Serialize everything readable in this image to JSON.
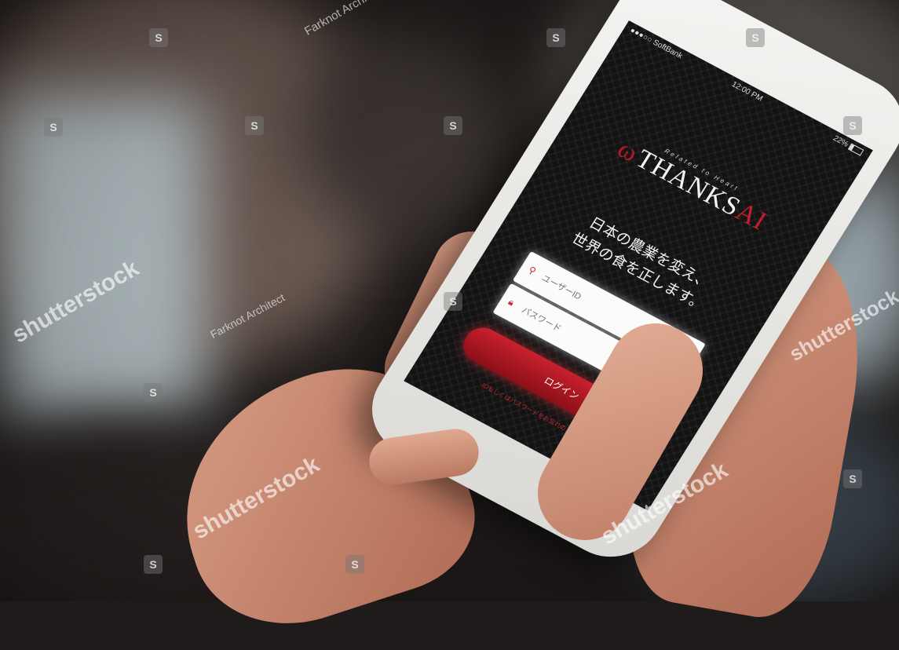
{
  "phone": {
    "status_bar": {
      "carrier": "●●●○○ SoftBank ",
      "time": "12:00 PM",
      "battery": "22%"
    },
    "logo": {
      "tagline": "Related to Heart",
      "text": "THANKS",
      "text_accent": "AI"
    },
    "slogan_line1": "日本の農業を変え、",
    "slogan_line2": "世界の食を正します。",
    "form": {
      "user_placeholder": "ユーザーID",
      "password_placeholder": "パスワード",
      "login_label": "ログイン",
      "forgot_text": "IDもしくはパスワードをお忘れの方はコチラから"
    }
  },
  "watermarks": {
    "brand": "shutterstock",
    "author": "Farknot Architect",
    "logo_glyph": "S"
  },
  "colors": {
    "accent_red": "#c41e2a",
    "screen_bg": "#141314"
  }
}
